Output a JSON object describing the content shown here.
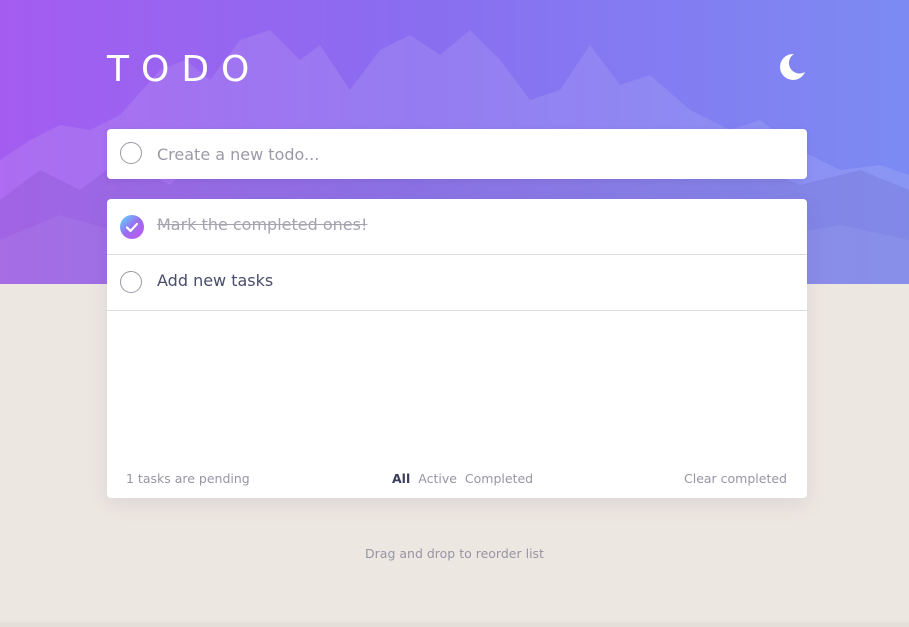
{
  "header": {
    "title": "TODO",
    "theme_toggle_icon": "moon-icon"
  },
  "create": {
    "placeholder": "Create a new todo..."
  },
  "todos": [
    {
      "text": "Mark the completed ones!",
      "completed": true
    },
    {
      "text": "Add new tasks",
      "completed": false
    }
  ],
  "footer": {
    "pending_text": "1 tasks are pending",
    "filters": [
      "All",
      "Active",
      "Completed"
    ],
    "active_filter": "All",
    "clear_label": "Clear completed"
  },
  "hint": "Drag and drop to reorder list",
  "colors": {
    "gradient_start": "#a45cf0",
    "gradient_end": "#7c8bf3",
    "check_gradient_start": "#55ddff",
    "check_gradient_end": "#c058f3",
    "page_background": "#ede7e1"
  }
}
